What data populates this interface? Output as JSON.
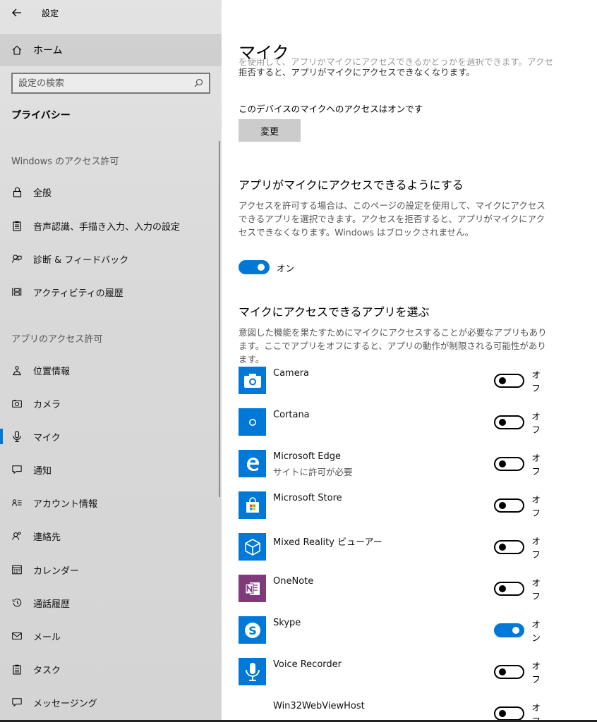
{
  "window": {
    "title": "設定"
  },
  "sidebar": {
    "home_label": "ホーム",
    "search_placeholder": "設定の検索",
    "section_title": "プライバシー",
    "group_windows": "Windows のアクセス許可",
    "group_apps": "アプリのアクセス許可",
    "windows_items": [
      {
        "label": "全般",
        "icon": "lock-icon"
      },
      {
        "label": "音声認識、手描き入力、入力の設定",
        "icon": "clipboard-icon"
      },
      {
        "label": "診断 & フィードバック",
        "icon": "feedback-icon"
      },
      {
        "label": "アクティビティの履歴",
        "icon": "timeline-icon"
      }
    ],
    "app_items": [
      {
        "label": "位置情報",
        "icon": "location-icon"
      },
      {
        "label": "カメラ",
        "icon": "camera-icon"
      },
      {
        "label": "マイク",
        "icon": "microphone-icon",
        "selected": true
      },
      {
        "label": "通知",
        "icon": "notification-icon"
      },
      {
        "label": "アカウント情報",
        "icon": "account-info-icon"
      },
      {
        "label": "連絡先",
        "icon": "contacts-icon"
      },
      {
        "label": "カレンダー",
        "icon": "calendar-icon"
      },
      {
        "label": "通話履歴",
        "icon": "history-icon"
      },
      {
        "label": "メール",
        "icon": "mail-icon"
      },
      {
        "label": "タスク",
        "icon": "tasks-icon"
      },
      {
        "label": "メッセージング",
        "icon": "messaging-icon"
      }
    ]
  },
  "main": {
    "title": "マイク",
    "intro_fade": "を使用して、アプリがマイクにアクセスできるかどうかを選択できます。アクセスを",
    "intro_line": "拒否すると、アプリがマイクにアクセスできなくなります。",
    "device_status": "このデバイスのマイクへのアクセスはオンです",
    "change_button": "変更",
    "allow_heading": "アプリがマイクにアクセスできるようにする",
    "allow_desc": "アクセスを許可する場合は、このページの設定を使用して、マイクにアクセスできるアプリを選択できます。アクセスを拒否すると、アプリがマイクにアクセスできなくなります。Windows はブロックされません。",
    "master_toggle": {
      "state": "on",
      "label": "オン"
    },
    "choose_heading": "マイクにアクセスできるアプリを選ぶ",
    "choose_desc": "意図した機能を果たすためにマイクにアクセスすることが必要なアプリもあります。ここでアプリをオフにすると、アプリの動作が制限される可能性があります。",
    "apps": [
      {
        "name": "Camera",
        "sub": "",
        "state": "off",
        "label": "オフ",
        "icon": "camera-app-icon",
        "color": "#0078d7"
      },
      {
        "name": "Cortana",
        "sub": "",
        "state": "off",
        "label": "オフ",
        "icon": "cortana-icon",
        "color": "#0078d7"
      },
      {
        "name": "Microsoft Edge",
        "sub": "サイトに許可が必要",
        "state": "off",
        "label": "オフ",
        "icon": "edge-icon",
        "color": "#0078d7"
      },
      {
        "name": "Microsoft Store",
        "sub": "",
        "state": "off",
        "label": "オフ",
        "icon": "store-icon",
        "color": "#0078d7"
      },
      {
        "name": "Mixed Reality ビューアー",
        "sub": "",
        "state": "off",
        "label": "オフ",
        "icon": "mixed-reality-icon",
        "color": "#0078d7"
      },
      {
        "name": "OneNote",
        "sub": "",
        "state": "off",
        "label": "オフ",
        "icon": "onenote-icon",
        "color": "#80397b"
      },
      {
        "name": "Skype",
        "sub": "",
        "state": "on",
        "label": "オン",
        "icon": "skype-icon",
        "color": "#0078d7"
      },
      {
        "name": "Voice Recorder",
        "sub": "",
        "state": "off",
        "label": "オフ",
        "icon": "voice-recorder-icon",
        "color": "#0078d7"
      },
      {
        "name": "Win32WebViewHost",
        "sub": "",
        "state": "off",
        "label": "オフ",
        "icon": "",
        "color": ""
      }
    ]
  },
  "colors": {
    "accent": "#0078d7",
    "sidebar_bg": "#dcdcdc",
    "onenote": "#80397b"
  }
}
